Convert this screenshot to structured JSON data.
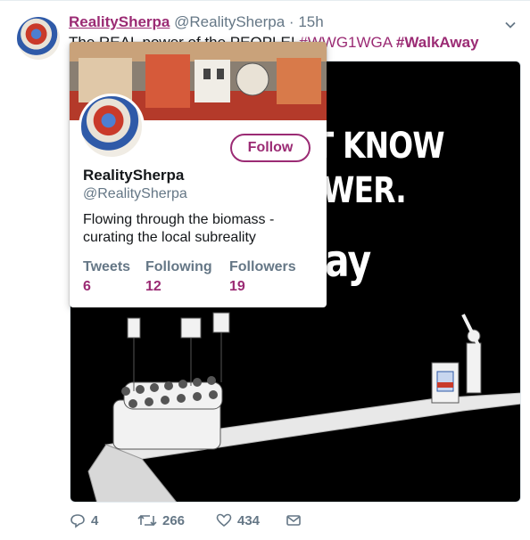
{
  "tweet": {
    "display_name": "RealitySherpa",
    "handle": "@RealitySherpa",
    "separator": "·",
    "time": "15h",
    "text_prefix": "The REAL power of the PEOPLE! ",
    "hashtag_1": "#WWG1WGA",
    "hashtag_2": "#WalkAway",
    "avatar_icon": "profile-avatar-icon",
    "menu_icon": "chevron-down-icon"
  },
  "media": {
    "line_1": "ON'T KNOW",
    "line_2": "POWER.",
    "line_3": "Away"
  },
  "actions": {
    "reply": {
      "icon": "reply-icon",
      "count": "4"
    },
    "retweet": {
      "icon": "retweet-icon",
      "count": "266"
    },
    "like": {
      "icon": "heart-icon",
      "count": "434"
    },
    "dm": {
      "icon": "envelope-icon"
    }
  },
  "hovercard": {
    "follow_label": "Follow",
    "name": "RealitySherpa",
    "handle": "@RealitySherpa",
    "bio": "Flowing through the biomass - curating the local subreality",
    "stats": [
      {
        "label": "Tweets",
        "value": "6"
      },
      {
        "label": "Following",
        "value": "12"
      },
      {
        "label": "Followers",
        "value": "19"
      }
    ]
  },
  "colors": {
    "accent": "#9b2b74",
    "secondary_text": "#657786",
    "primary_text": "#14171a"
  }
}
